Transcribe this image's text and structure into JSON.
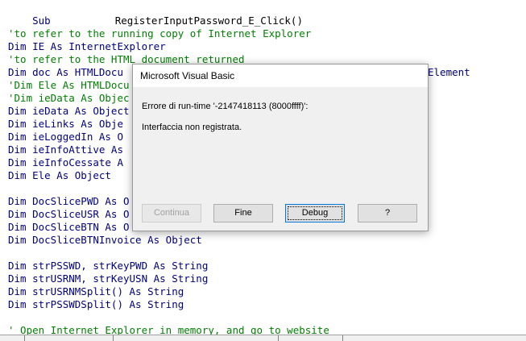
{
  "code": {
    "sub_prefix": "Sub",
    "sub_name": "RegisterInputPassword_E_Click()",
    "lines": [
      {
        "type": "comment",
        "text": "'to refer to the running copy of Internet Explorer"
      },
      {
        "type": "code",
        "text": "Dim IE As InternetExplorer"
      },
      {
        "type": "comment",
        "text": "'to refer to the HTML document returned"
      },
      {
        "type": "code",
        "text": "Dim doc As HTMLDocu"
      },
      {
        "type": "comment",
        "text": "'Dim Ele As HTMLDocu"
      },
      {
        "type": "comment",
        "text": "'Dim ieData As Objec"
      },
      {
        "type": "code",
        "text": "Dim ieData As Object"
      },
      {
        "type": "code",
        "text": "Dim ieLinks As Obje"
      },
      {
        "type": "code",
        "text": "Dim ieLoggedIn As O"
      },
      {
        "type": "code",
        "text": "Dim ieInfoAttive As"
      },
      {
        "type": "code",
        "text": "Dim ieInfoCessate A"
      },
      {
        "type": "code",
        "text": "Dim Ele As Object"
      },
      {
        "type": "code",
        "text": "Dim DocSlicePWD As O"
      },
      {
        "type": "code",
        "text": "Dim DocSliceUSR As O"
      },
      {
        "type": "code",
        "text": "Dim DocSliceBTN As O"
      },
      {
        "type": "code",
        "text": "Dim DocSliceBTNInvoice As Object"
      },
      {
        "type": "code",
        "text": "Dim strPSSWD, strKeyPWD As String"
      },
      {
        "type": "code",
        "text": "Dim strUSRNM, strKeyUSN As String"
      },
      {
        "type": "code",
        "text": "Dim strUSRNMSplit() As String"
      },
      {
        "type": "code",
        "text": "Dim strPSSWDSplit() As String"
      },
      {
        "type": "comment",
        "text": "' Open Internet Explorer in memory, and go to website"
      }
    ],
    "right_fragment": "Element"
  },
  "dialog": {
    "title": "Microsoft Visual Basic",
    "error_line": "Errore di run-time '-2147418113 (8000ffff)':",
    "error_message": "Interfaccia non registrata.",
    "buttons": {
      "continue": "Continua",
      "end": "Fine",
      "debug": "Debug",
      "help": "?"
    }
  }
}
